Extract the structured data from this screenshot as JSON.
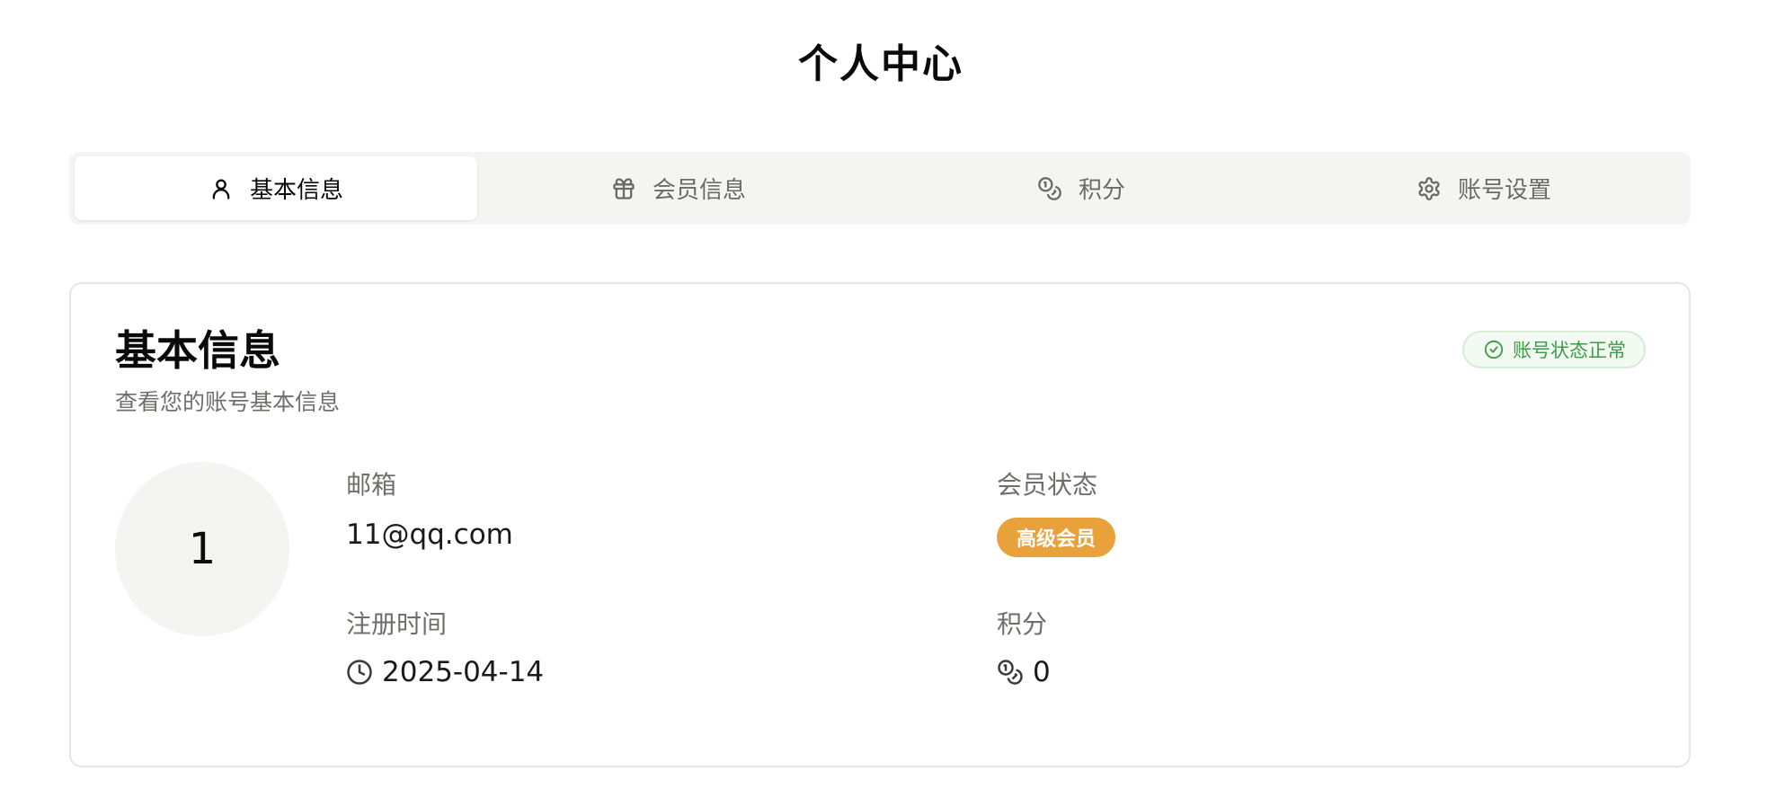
{
  "page": {
    "title": "个人中心"
  },
  "tabs": [
    {
      "label": "基本信息",
      "icon": "user-icon",
      "active": true
    },
    {
      "label": "会员信息",
      "icon": "gift-icon",
      "active": false
    },
    {
      "label": "积分",
      "icon": "coins-icon",
      "active": false
    },
    {
      "label": "账号设置",
      "icon": "gear-icon",
      "active": false
    }
  ],
  "card": {
    "title": "基本信息",
    "subtitle": "查看您的账号基本信息",
    "status_badge": "账号状态正常",
    "avatar_text": "1",
    "email_label": "邮箱",
    "email_value": "11@qq.com",
    "member_label": "会员状态",
    "member_value": "高级会员",
    "register_label": "注册时间",
    "register_value": "2025-04-14",
    "points_label": "积分",
    "points_value": "0"
  },
  "colors": {
    "status_green": "#3d9a48",
    "member_orange": "#e9a23b",
    "tab_bg": "#f4f4f2"
  }
}
